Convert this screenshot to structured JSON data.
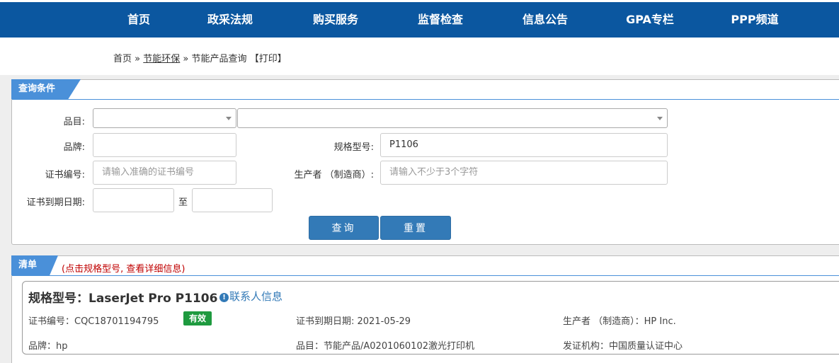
{
  "nav": {
    "items": [
      {
        "label": "首页"
      },
      {
        "label": "政采法规"
      },
      {
        "label": "购买服务"
      },
      {
        "label": "监督检查"
      },
      {
        "label": "信息公告"
      },
      {
        "label": "GPA专栏"
      },
      {
        "label": "PPP频道"
      }
    ]
  },
  "breadcrumb": {
    "home": "首页",
    "sep1": "»",
    "section": "节能环保",
    "sep2": "»",
    "current": "节能产品查询",
    "print": "【打印】"
  },
  "query": {
    "tab_label": "查询条件",
    "category_label": "品目:",
    "brand_label": "品牌:",
    "brand_value": "",
    "model_label": "规格型号:",
    "model_value": "P1106",
    "cert_no_label": "证书编号:",
    "cert_no_placeholder": "请输入准确的证书编号",
    "manufacturer_label": "生产者 （制造商）:",
    "manufacturer_placeholder": "请输入不少于3个字符",
    "expiry_label": "证书到期日期:",
    "to_label": "至",
    "search_button": "查询",
    "reset_button": "重置"
  },
  "results": {
    "tab_label": "清单",
    "hint": "(点击规格型号, 查看详细信息)",
    "items": [
      {
        "title": "规格型号：LaserJet Pro P1106",
        "contact_link": "联系人信息",
        "cert_no": "证书编号：CQC18701194795",
        "status": "有效",
        "expiry": "证书到期日期: 2021-05-29",
        "manufacturer": "生产者 （制造商）：HP Inc.",
        "brand": "品牌：hp",
        "category": "品目：节能产品/A0201060102激光打印机",
        "issuer": "发证机构：中国质量认证中心"
      }
    ]
  },
  "colors": {
    "nav_bg": "#0b57a0",
    "tab_bg": "#4a90d9",
    "button_bg": "#337ab7",
    "badge_bg": "#1e9a3f",
    "hint_color": "#c00000"
  }
}
